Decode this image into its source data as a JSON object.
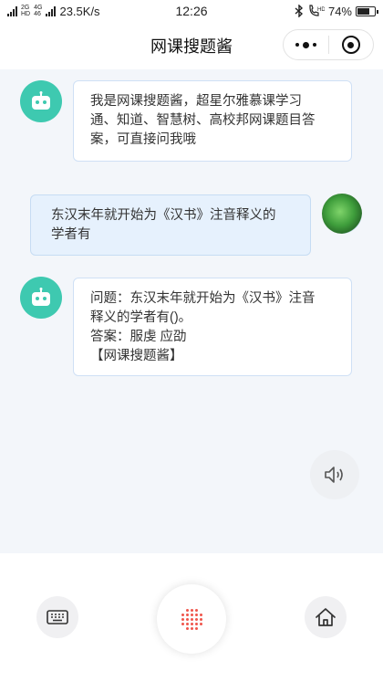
{
  "status_bar": {
    "net_small_top": "2G",
    "net_small_top2": "4G",
    "net_small_bottom": "HD",
    "net_small_bottom2": "46",
    "speed": "23.5K/s",
    "time": "12:26",
    "battery_percent": "74%",
    "battery_level": 0.74
  },
  "nav": {
    "title": "网课搜题酱"
  },
  "chat": {
    "messages": [
      {
        "role": "bot",
        "text": "我是网课搜题酱，超星尔雅慕课学习\n通、知道、智慧树、高校邦网课题目答\n案，可直接问我哦"
      },
      {
        "role": "user",
        "text": "东汉末年就开始为《汉书》注音释义的\n学者有"
      },
      {
        "role": "bot",
        "text": "问题：东汉末年就开始为《汉书》注音\n释义的学者有()。\n答案：服虔 应劭\n【网课搜题酱】"
      }
    ]
  },
  "colors": {
    "bot_avatar": "#3ec9b0",
    "mic_dots": "#f0554b",
    "user_bubble": "#e6f1fd"
  },
  "icons": {
    "nav_more": "more-dots-icon",
    "nav_close": "target-circle-icon",
    "speaker": "speaker-icon",
    "keyboard": "keyboard-icon",
    "mic": "voice-dots-icon",
    "home": "home-icon"
  }
}
